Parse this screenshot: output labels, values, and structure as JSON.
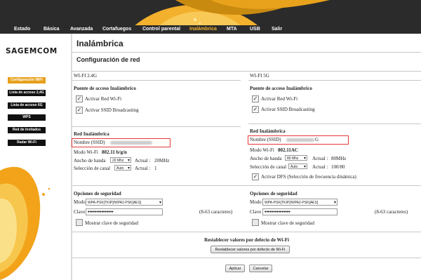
{
  "nav": {
    "items": [
      "Estado",
      "Básica",
      "Avanzada",
      "Cortafuegos",
      "Control parental",
      "Inalámbrica",
      "MTA",
      "USB",
      "Salir"
    ],
    "active_index": 5
  },
  "brand": {
    "logo_text": "SAGEMCOM",
    "accent_color": "#e6a01c"
  },
  "sidebar": {
    "items": [
      "Configuración WiFi",
      "Lista de acceso 2,4G",
      "Lista de acceso 6G",
      "WPS",
      "Red de Invitados",
      "Radar Wi-Fi"
    ],
    "active_index": 0
  },
  "page": {
    "title": "Inalámbrica",
    "section_title": "Configuración de red"
  },
  "wifi24": {
    "band_label": "WI-FI 2.4G",
    "ap_title": "Puente de acceso Inalámbrico",
    "enable_wifi_label": "Activar Red Wi-Fi",
    "enable_wifi_checked": true,
    "ssid_broadcast_label": "Activar SSID Broadcasting",
    "ssid_broadcast_checked": true,
    "network_title": "Red Inalámbrica",
    "ssid_label": "Nombre (SSID)",
    "mode_label": "Modo Wi-Fi",
    "mode_value": "802.11 b/g/n",
    "bandwidth_label": "Ancho de banda",
    "bandwidth_value": "20 Mhz",
    "bandwidth_actual_label": "Actual :",
    "bandwidth_actual_value": "20MHz",
    "channel_label": "Selección de canal",
    "channel_value": "Auto",
    "channel_actual_label": "Actual :",
    "channel_actual_value": "1",
    "security_title": "Opciones de seguridad",
    "security_mode_label": "Modo",
    "security_mode_value": "WPA-PSK[TKIP]/WPA2-PSK[AES]",
    "key_label": "Clave",
    "key_value": "•••••••••••••••",
    "key_hint": "(8-63 caracteres)",
    "show_key_label": "Mostrar clave de seguridad",
    "show_key_checked": false
  },
  "wifi5": {
    "band_label": "WI-FI 5G",
    "ap_title": "Puente de acceso Inalámbrico",
    "enable_wifi_label": "Activar Red Wi-Fi",
    "enable_wifi_checked": true,
    "ssid_broadcast_label": "Activar SSID Broadcasting",
    "ssid_broadcast_checked": true,
    "network_title": "Red Inalámbrica",
    "ssid_label": "Nombre (SSID)",
    "ssid_suffix": "G",
    "mode_label": "Modo Wi-Fi",
    "mode_value": "802.11AC",
    "bandwidth_label": "Ancho de banda",
    "bandwidth_value": "80 Mhz",
    "bandwidth_actual_label": "Actual :",
    "bandwidth_actual_value": "80MHz",
    "channel_label": "Selección de canal",
    "channel_value": "Auto",
    "channel_actual_label": "Actual :",
    "channel_actual_value": "100/80",
    "dfs_label": "Activar DFS (Selección de frecuencia dinámica)",
    "dfs_checked": true,
    "security_title": "Opciones de seguridad",
    "security_mode_label": "Modo",
    "security_mode_value": "WPA-PSK[TKIP]/WPA2-PSK[AES]",
    "key_label": "Clave",
    "key_value": "•••••••••••••••",
    "key_hint": "(8-63 caracteres)",
    "show_key_label": "Mostrar clave de seguridad",
    "show_key_checked": false
  },
  "reset": {
    "title": "Restablecer valores por defecto de Wi-Fi",
    "button_label": "Restablecer valores por defecto de Wi-Fi"
  },
  "actions": {
    "apply_label": "Aplicar",
    "cancel_label": "Cancelar"
  },
  "icons": {
    "checkbox_checked": "checkmark-icon",
    "dropdown": "chevron-down-icon"
  }
}
